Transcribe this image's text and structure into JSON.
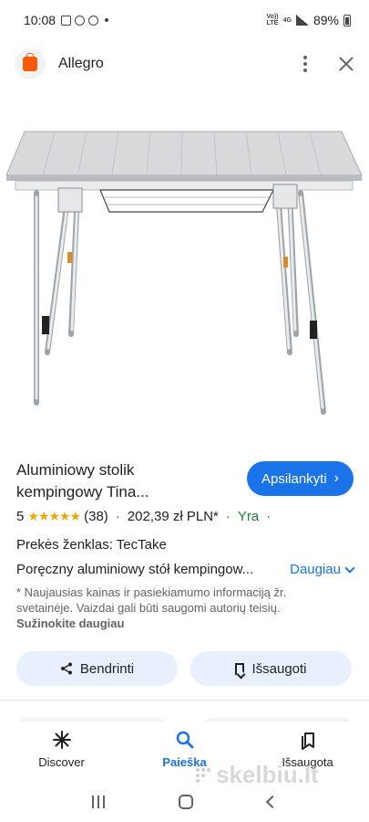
{
  "status_bar": {
    "time": "10:08",
    "network_top": "Vo))",
    "network_bottom": "LTE",
    "network_gen": "4G",
    "battery": "89%"
  },
  "header": {
    "app_name": "Allegro"
  },
  "product": {
    "title": "Aluminiowy stolik kempingowy Tina...",
    "visit_label": "Apsilankyti",
    "rating_value": "5",
    "stars": "★★★★★",
    "review_count": "(38)",
    "price": "202,39 zł PLN*",
    "stock": "Yra",
    "brand": "Prekės ženklas: TecTake",
    "description": "Poręczny aluminiowy stół kempingow...",
    "more_label": "Daugiau",
    "disclaimer": "* Naujausias kainas ir pasiekiamumo informaciją žr. svetainėje. Vaizdai gali būti saugomi autorių teisių.",
    "disclaimer_link": "Sužinokite daugiau"
  },
  "actions": {
    "share_label": "Bendrinti",
    "save_label": "Išsaugoti"
  },
  "bottom_nav": {
    "discover": "Discover",
    "search": "Paieška",
    "saved": "Išsaugota"
  },
  "watermark": "skelbiu.lt",
  "colors": {
    "accent": "#1a73e8",
    "stock": "#188038",
    "stars": "#e8a90c",
    "brand_orange": "#ff5a00"
  }
}
